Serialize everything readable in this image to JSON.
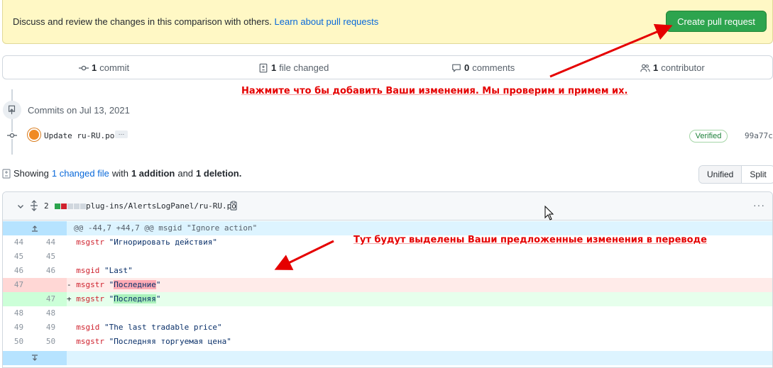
{
  "banner": {
    "text": "Discuss and review the changes in this comparison with others.",
    "link": "Learn about pull requests",
    "button": "Create pull request"
  },
  "stats": {
    "commits_count": "1",
    "commits_label": "commit",
    "files_count": "1",
    "files_label": "file changed",
    "comments_count": "0",
    "comments_label": "comments",
    "contributors_count": "1",
    "contributors_label": "contributor"
  },
  "annotations": {
    "top": "Нажмите что бы добавить Ваши изменения. Мы проверим и примем их.",
    "middle": "Тут будут выделены Ваши предложенные изменения в переводе"
  },
  "timeline": {
    "date_heading": "Commits on Jul 13, 2021",
    "commit_message": "Update ru-RU.po",
    "ellipsis": "…",
    "verified": "Verified",
    "sha": "99a77cf"
  },
  "showing": {
    "prefix": "Showing",
    "link": "1 changed file",
    "with": "with",
    "additions": "1 addition",
    "and": "and",
    "deletions": "1 deletion."
  },
  "view_toggle": {
    "unified": "Unified",
    "split": "Split"
  },
  "file": {
    "changes": "2",
    "path": "plug-ins/AlertsLogPanel/ru-RU.po",
    "hunk": "@@ -44,7 +44,7 @@ msgid \"Ignore action\"",
    "lines": [
      {
        "old": "44",
        "new": "44",
        "sign": " ",
        "kw": "msgstr",
        "val": "\"Игнорировать действия\"",
        "type": "ctx"
      },
      {
        "old": "45",
        "new": "45",
        "sign": " ",
        "kw": "",
        "val": "",
        "type": "ctx"
      },
      {
        "old": "46",
        "new": "46",
        "sign": " ",
        "kw": "msgid",
        "val": "\"Last\"",
        "type": "ctx"
      },
      {
        "old": "47",
        "new": "",
        "sign": "-",
        "kw": "msgstr",
        "val": "Последние",
        "type": "del"
      },
      {
        "old": "",
        "new": "47",
        "sign": "+",
        "kw": "msgstr",
        "val": "Последняя",
        "type": "add"
      },
      {
        "old": "48",
        "new": "48",
        "sign": " ",
        "kw": "",
        "val": "",
        "type": "ctx"
      },
      {
        "old": "49",
        "new": "49",
        "sign": " ",
        "kw": "msgid",
        "val": "\"The last tradable price\"",
        "type": "ctx"
      },
      {
        "old": "50",
        "new": "50",
        "sign": " ",
        "kw": "msgstr",
        "val": "\"Последняя торгуемая цена\"",
        "type": "ctx"
      }
    ]
  },
  "colors": {
    "accent_green": "#2da44e",
    "link_blue": "#0969da",
    "annotation_red": "#e50000"
  }
}
